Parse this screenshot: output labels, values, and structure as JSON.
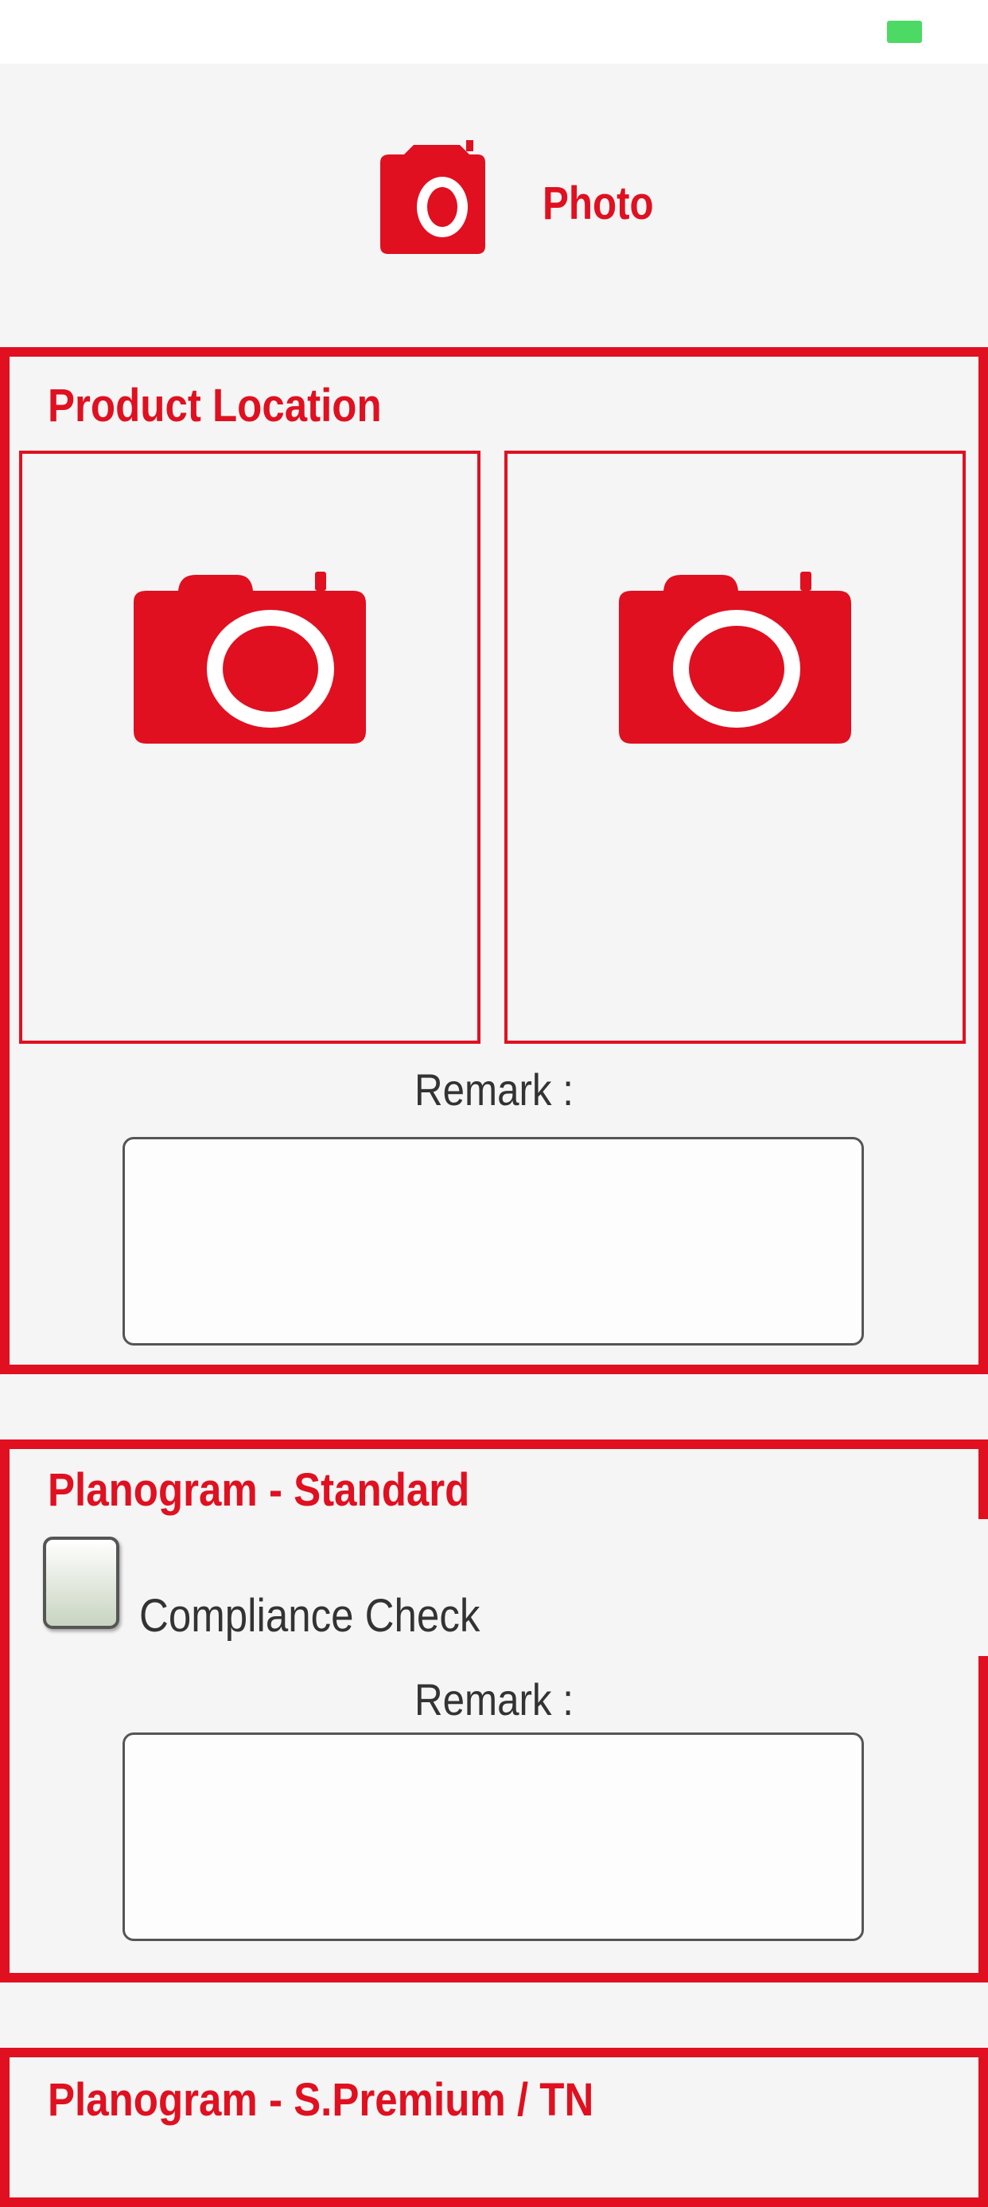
{
  "header": {
    "title": "Photo",
    "icon": "camera-icon"
  },
  "sections": {
    "product_location": {
      "title": "Product Location",
      "photo_slots": [
        "camera-icon",
        "camera-icon"
      ],
      "remark_label": "Remark :",
      "remark_value": ""
    },
    "planogram_standard": {
      "title": "Planogram - Standard",
      "checkbox_label": "Compliance Check",
      "checked": false,
      "remark_label": "Remark :",
      "remark_value": ""
    },
    "planogram_spremium": {
      "title": "Planogram - S.Premium / TN"
    }
  },
  "colors": {
    "accent": "#e01020",
    "background": "#f5f5f5",
    "battery": "#4cd964"
  }
}
